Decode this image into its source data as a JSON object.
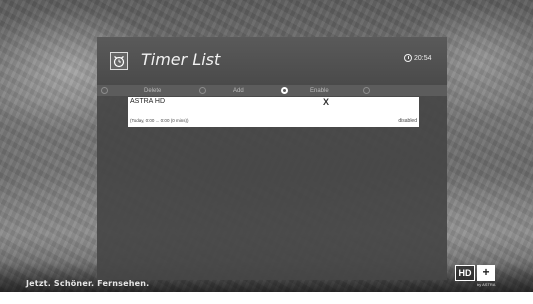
{
  "panel": {
    "title": "Timer List",
    "clock": "20:54"
  },
  "actions": [
    {
      "label": "Delete",
      "active": false
    },
    {
      "label": "Add",
      "active": false
    },
    {
      "label": "Enable",
      "active": true
    }
  ],
  "timers": [
    {
      "channel": "ASTRA HD",
      "mark": "X",
      "time": "(Today, 0:00 ... 0:00 (0 mins))",
      "status": "disabled"
    }
  ],
  "footer": {
    "tagline": "Jetzt. Schöner. Fernsehen.",
    "logo_hd": "HD",
    "logo_plus": "+",
    "logo_caption": "by ASTRA"
  },
  "icons": {
    "timer": "alarm-clock-icon",
    "clock": "clock-icon"
  }
}
